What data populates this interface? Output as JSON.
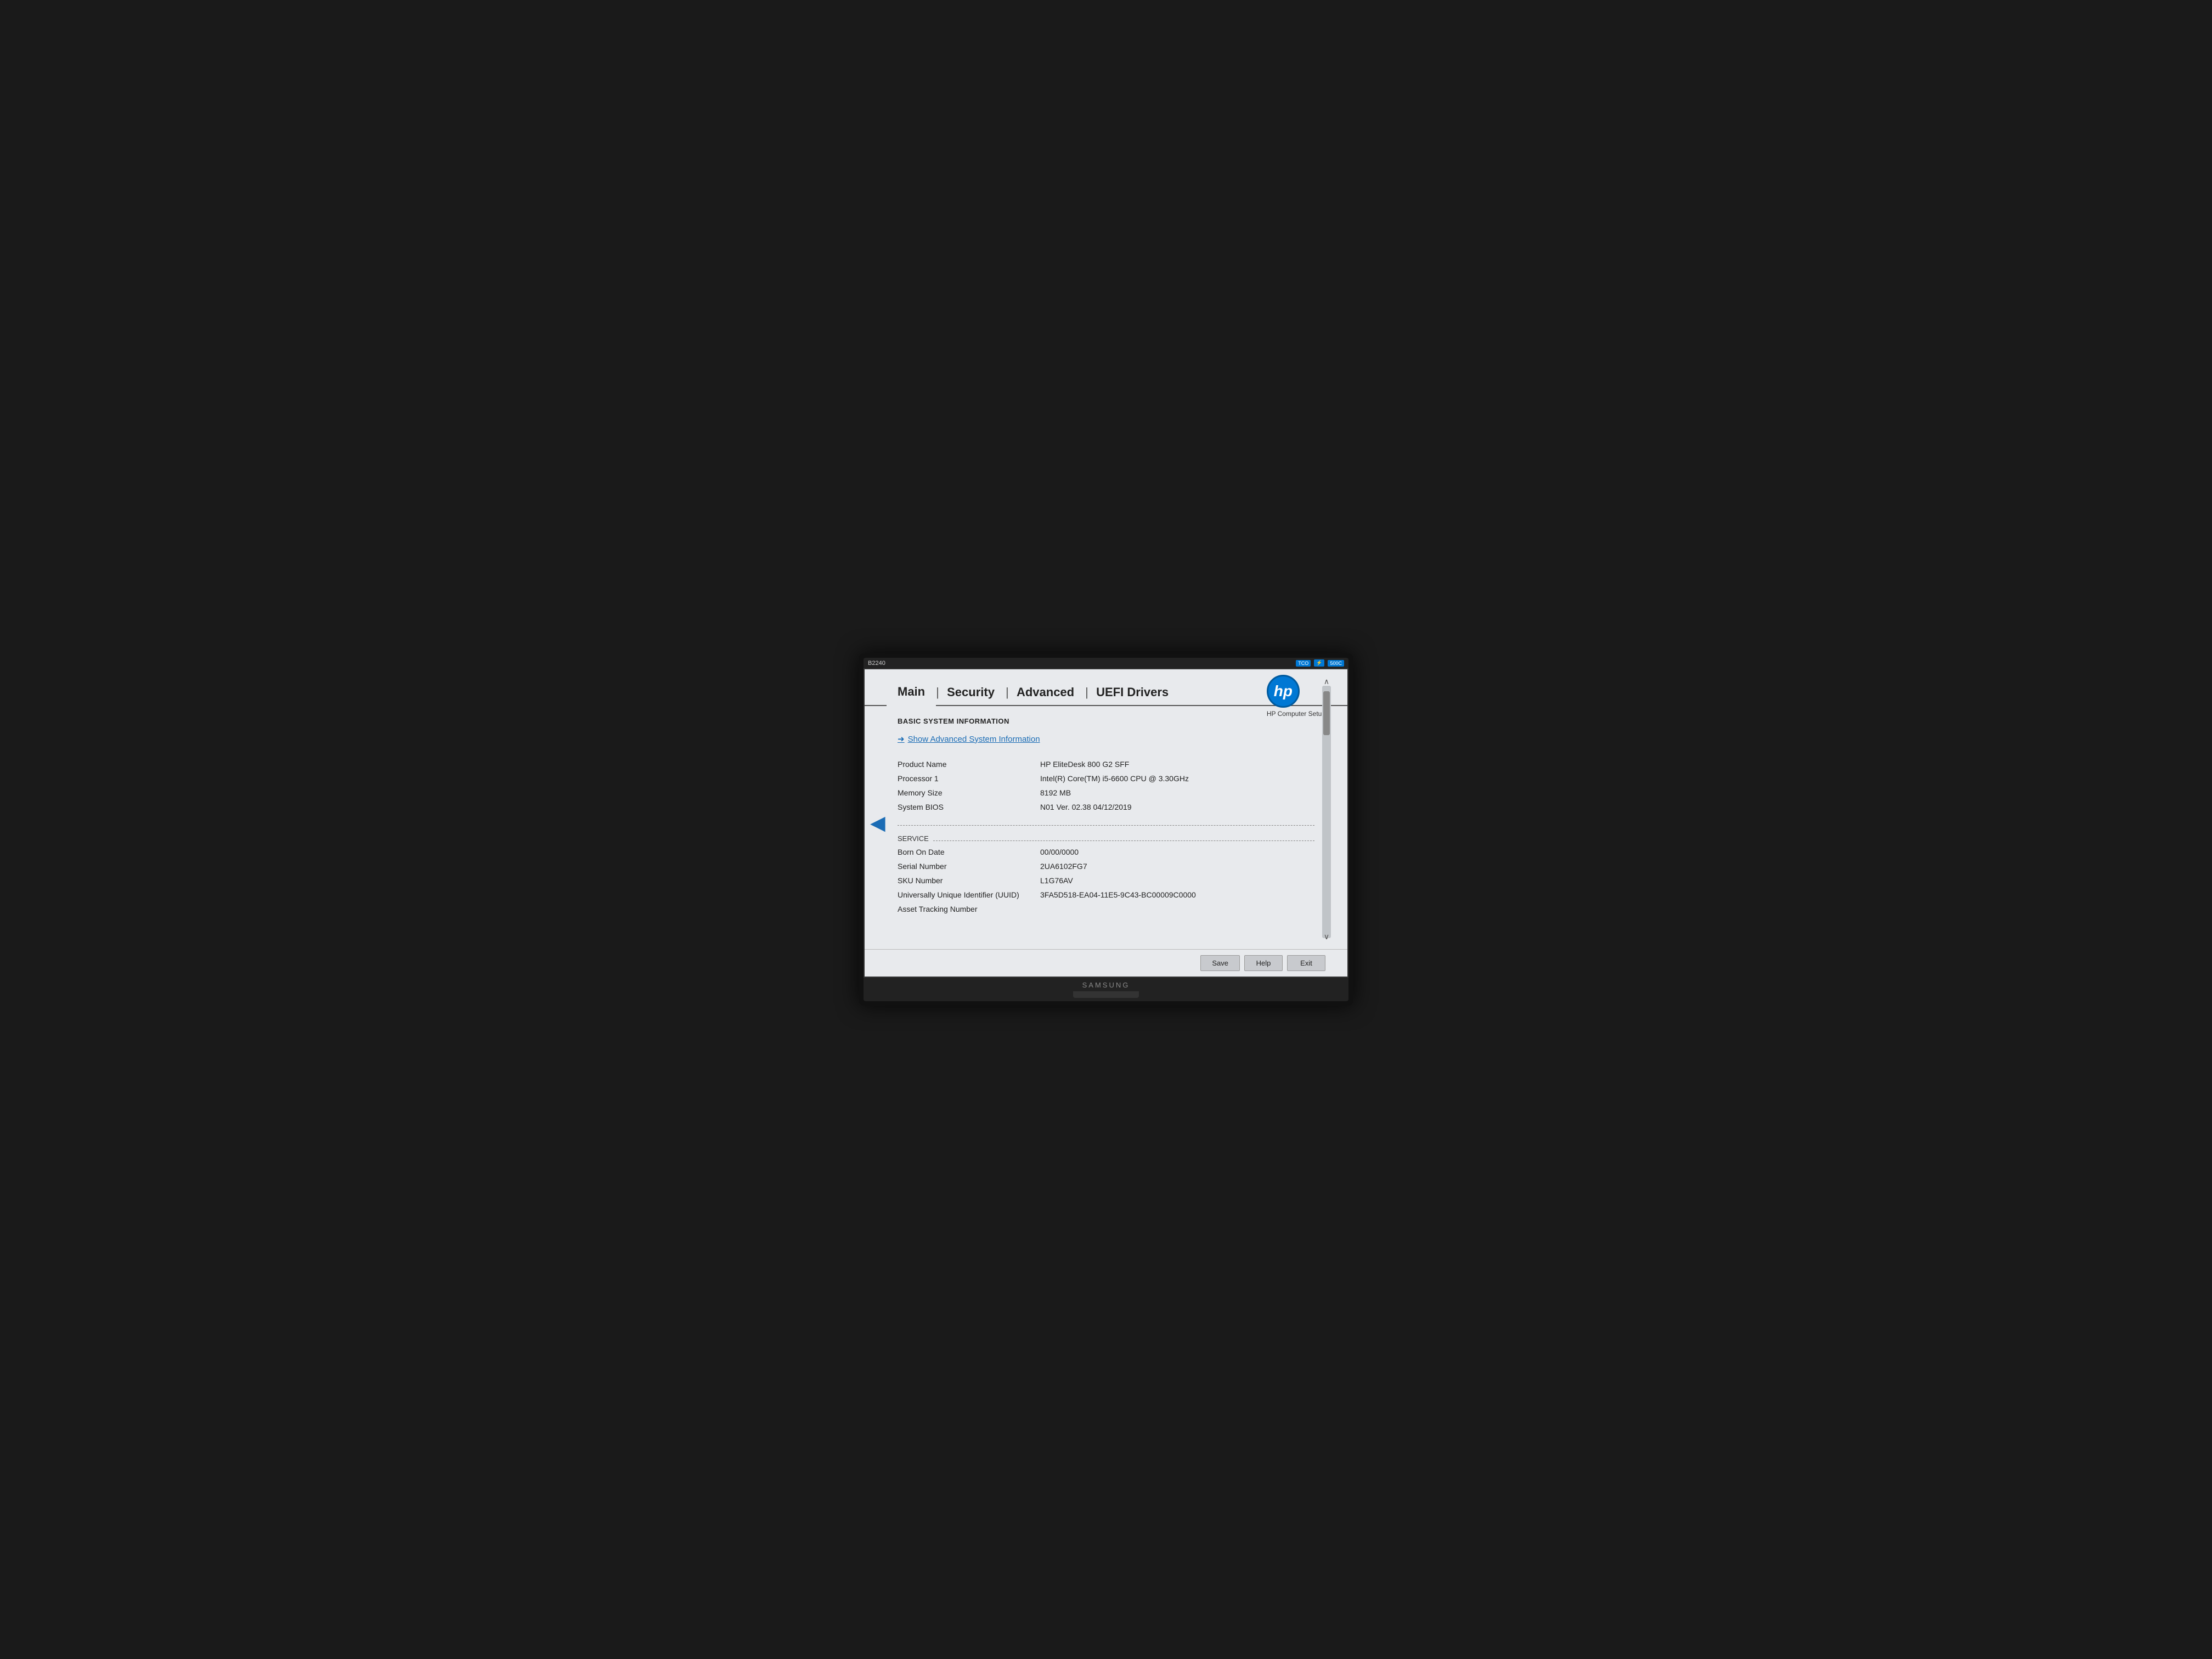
{
  "monitor": {
    "model": "B2240",
    "brand": "SAMSUNG"
  },
  "topbar": {
    "model_label": "B2240",
    "icons": [
      "TCO",
      "energy-star",
      "500C"
    ]
  },
  "nav": {
    "tabs": [
      {
        "label": "Main",
        "active": true
      },
      {
        "label": "Security",
        "active": false
      },
      {
        "label": "Advanced",
        "active": false
      },
      {
        "label": "UEFI Drivers",
        "active": false
      }
    ]
  },
  "hp": {
    "logo_text": "hp",
    "subtitle": "HP Computer Setup"
  },
  "content": {
    "section_title": "BASIC SYSTEM INFORMATION",
    "advanced_link": "Show Advanced System Information",
    "fields": [
      {
        "label": "Product Name",
        "value": "HP EliteDesk 800 G2 SFF"
      },
      {
        "label": "Processor 1",
        "value": "Intel(R) Core(TM) i5-6600 CPU @ 3.30GHz"
      },
      {
        "label": "Memory Size",
        "value": "8192 MB"
      },
      {
        "label": "System BIOS",
        "value": "N01 Ver. 02.38  04/12/2019"
      }
    ],
    "service_section": {
      "header": "SERVICE",
      "fields": [
        {
          "label": "Born On Date",
          "value": "00/00/0000"
        },
        {
          "label": "Serial Number",
          "value": "2UA6102FG7"
        },
        {
          "label": "SKU Number",
          "value": "L1G76AV"
        },
        {
          "label": "Universally Unique Identifier (UUID)",
          "value": "3FA5D518-EA04-11E5-9C43-BC00009C0000"
        },
        {
          "label": "Asset Tracking Number",
          "value": ""
        }
      ]
    }
  },
  "buttons": {
    "save": "Save",
    "help": "Help",
    "exit": "Exit"
  }
}
